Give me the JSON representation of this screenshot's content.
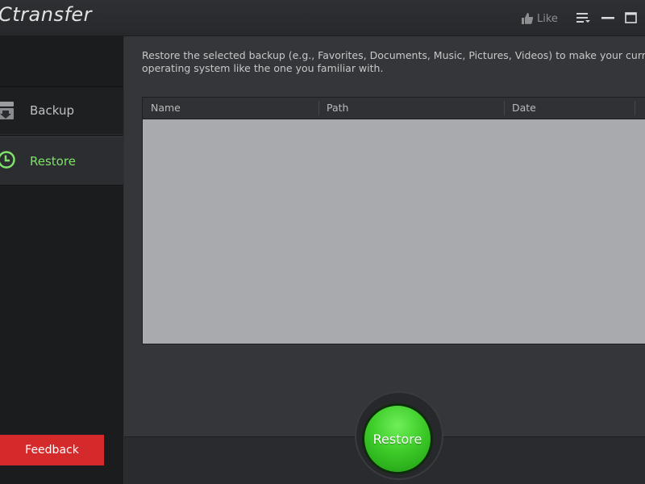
{
  "window": {
    "title": "Ctransfer",
    "like_label": "Like"
  },
  "sidebar": {
    "items": [
      {
        "label": "Backup",
        "icon": "backup-icon"
      },
      {
        "label": "Restore",
        "icon": "clock-icon",
        "selected": true
      }
    ],
    "feedback_label": "Feedback"
  },
  "main": {
    "description_line1": "Restore the selected backup (e.g., Favorites, Documents, Music, Pictures, Videos) to make your current",
    "description_line2": "operating system like the one you familiar with.",
    "table": {
      "columns": [
        "Name",
        "Path",
        "Date"
      ],
      "rows": []
    },
    "restore_button_label": "Restore"
  },
  "colors": {
    "accent_green": "#7fe06a",
    "feedback_red": "#d42a2c",
    "button_green": "#3fcd2a"
  }
}
